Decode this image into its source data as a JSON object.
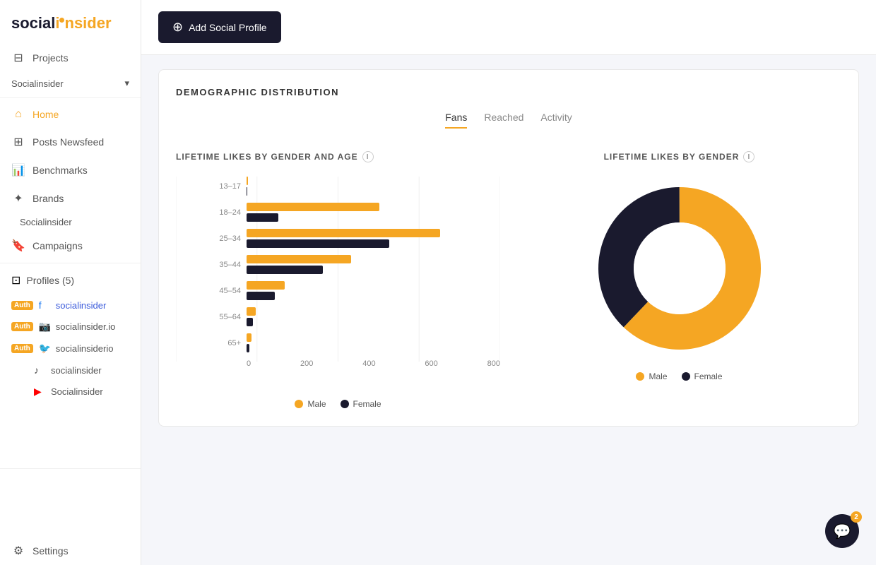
{
  "app": {
    "name": "socialinsider",
    "logo_highlight": "in"
  },
  "topbar": {
    "add_profile_label": "Add Social Profile"
  },
  "sidebar": {
    "projects_label": "Projects",
    "project_name": "Socialinsider",
    "nav_items": [
      {
        "id": "home",
        "label": "Home",
        "icon": "🏠",
        "active": true
      },
      {
        "id": "posts",
        "label": "Posts Newsfeed",
        "icon": "⊞"
      },
      {
        "id": "benchmarks",
        "label": "Benchmarks",
        "icon": "📊"
      },
      {
        "id": "brands",
        "label": "Brands",
        "icon": "✦"
      },
      {
        "id": "brand_sub",
        "label": "Socialinsider",
        "sub": true
      },
      {
        "id": "campaigns",
        "label": "Campaigns",
        "icon": "🔖"
      }
    ],
    "profiles_label": "Profiles (5)",
    "profiles": [
      {
        "id": "fb",
        "auth": true,
        "platform": "f",
        "name": "socialinsider",
        "link": true
      },
      {
        "id": "ig",
        "auth": true,
        "platform": "ig",
        "name": "socialinsider.io",
        "link": false
      },
      {
        "id": "tw",
        "auth": true,
        "platform": "tw",
        "name": "socialinsiderio",
        "link": false
      },
      {
        "id": "tt",
        "auth": false,
        "platform": "tt",
        "name": "socialinsider",
        "link": false
      },
      {
        "id": "yt",
        "auth": false,
        "platform": "yt",
        "name": "Socialinsider",
        "link": false
      }
    ],
    "settings_label": "Settings"
  },
  "main": {
    "section_title": "DEMOGRAPHIC DISTRIBUTION",
    "tabs": [
      {
        "label": "Fans",
        "active": true
      },
      {
        "label": "Reached",
        "active": false
      },
      {
        "label": "Activity",
        "active": false
      }
    ],
    "bar_chart": {
      "title": "LIFETIME LIKES BY GENDER AND AGE",
      "labels": [
        "13–17",
        "18–24",
        "25–34",
        "35–44",
        "45–54",
        "55–64",
        "65+"
      ],
      "male_values": [
        5,
        420,
        610,
        330,
        120,
        30,
        15
      ],
      "female_values": [
        3,
        100,
        450,
        240,
        90,
        20,
        10
      ],
      "x_axis": [
        "0",
        "200",
        "400",
        "600",
        "800"
      ],
      "max_value": 800,
      "legend": [
        {
          "label": "Male",
          "color": "#f5a623"
        },
        {
          "label": "Female",
          "color": "#1a1a2e"
        }
      ]
    },
    "donut_chart": {
      "title": "LIFETIME LIKES BY GENDER",
      "male_percent": 62,
      "female_percent": 38,
      "male_color": "#f5a623",
      "female_color": "#1a1a2e",
      "legend": [
        {
          "label": "Male",
          "color": "#f5a623"
        },
        {
          "label": "Female",
          "color": "#1a1a2e"
        }
      ]
    }
  },
  "chat_widget": {
    "badge": "2"
  }
}
